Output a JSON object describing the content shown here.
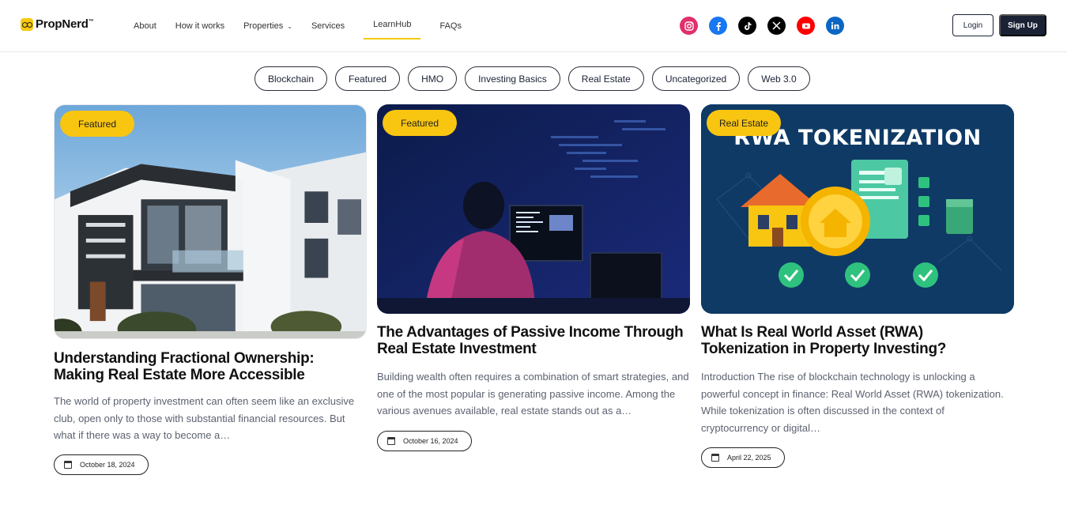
{
  "brand": {
    "name": "PropNerd",
    "tm": "™"
  },
  "nav": {
    "items": [
      {
        "label": "About"
      },
      {
        "label": "How it works"
      },
      {
        "label": "Properties"
      },
      {
        "label": "Services"
      },
      {
        "label": "LearnHub"
      },
      {
        "label": "FAQs"
      }
    ]
  },
  "socials": [
    {
      "name": "instagram-icon",
      "color": "#e1306c"
    },
    {
      "name": "facebook-icon",
      "color": "#1877f2"
    },
    {
      "name": "tiktok-icon",
      "color": "#000000"
    },
    {
      "name": "x-icon",
      "color": "#000000"
    },
    {
      "name": "youtube-icon",
      "color": "#ff0000"
    },
    {
      "name": "linkedin-icon",
      "color": "#0a66c2"
    }
  ],
  "auth": {
    "login": "Login",
    "signup": "Sign Up"
  },
  "filters": [
    "Blockchain",
    "Featured",
    "HMO",
    "Investing Basics",
    "Real Estate",
    "Uncategorized",
    "Web 3.0"
  ],
  "cards": [
    {
      "badge": "Featured",
      "title": "Understanding Fractional Ownership: Making Real Estate More Accessible",
      "excerpt": "The world of property investment can often seem like an exclusive club, open only to those with substantial financial resources. But what if there was a way to become a…",
      "date": "October 18, 2024"
    },
    {
      "badge": "Featured",
      "title": "The Advantages of Passive Income Through Real Estate Investment",
      "excerpt": "Building wealth often requires a combination of smart strategies, and one of the most popular is generating passive income. Among the various avenues available, real estate stands out as a…",
      "date": "October 16, 2024"
    },
    {
      "badge": "Real Estate",
      "title": "What Is Real World Asset (RWA) Tokenization in Property Investing?",
      "excerpt": "Introduction The rise of blockchain technology is unlocking a powerful concept in finance: Real World Asset (RWA) tokenization. While tokenization is often discussed in the context of cryptocurrency or digital…",
      "date": "April 22, 2025",
      "image_text": "RWA TOKENIZATION"
    }
  ],
  "colors": {
    "accent": "#f8c511",
    "dark": "#1b2235"
  }
}
